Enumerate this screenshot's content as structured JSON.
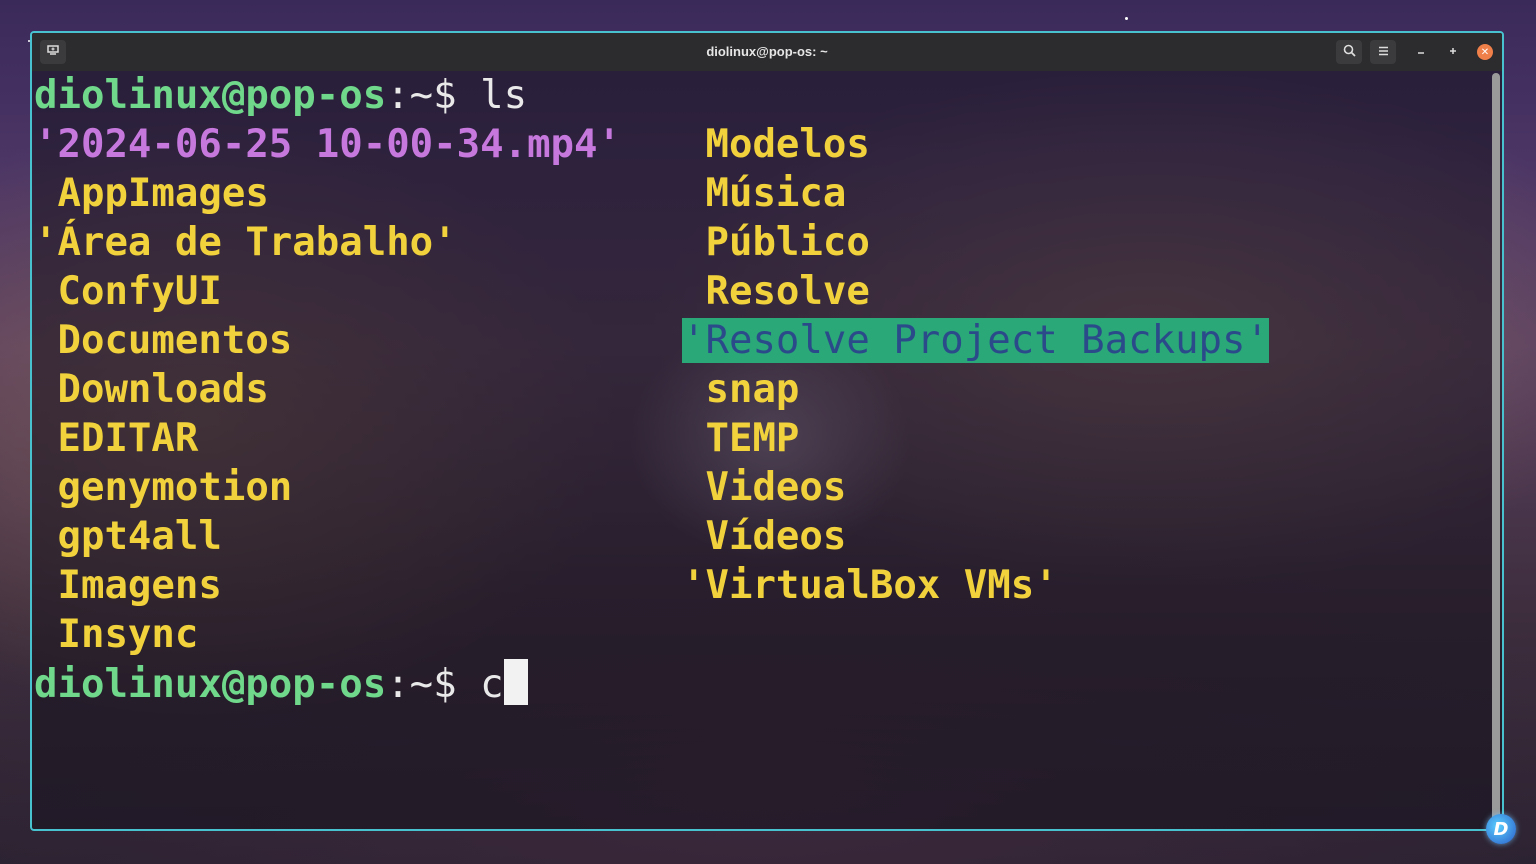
{
  "window": {
    "title": "diolinux@pop-os: ~"
  },
  "terminal": {
    "prompt": "diolinux@pop-os",
    "prompt_sep": ":~$",
    "command_1": "ls",
    "command_2_typed": "c",
    "left_column": [
      {
        "text": "'2024-06-25 10-00-34.mp4'",
        "kind": "file-video"
      },
      {
        "text": " AppImages",
        "kind": "dir"
      },
      {
        "text": "'Área de Trabalho'",
        "kind": "dir"
      },
      {
        "text": " ConfyUI",
        "kind": "dir"
      },
      {
        "text": " Documentos",
        "kind": "dir"
      },
      {
        "text": " Downloads",
        "kind": "dir"
      },
      {
        "text": " EDITAR",
        "kind": "dir"
      },
      {
        "text": " genymotion",
        "kind": "dir"
      },
      {
        "text": " gpt4all",
        "kind": "dir"
      },
      {
        "text": " Imagens",
        "kind": "dir"
      },
      {
        "text": " Insync",
        "kind": "dir"
      }
    ],
    "right_column": [
      {
        "text": " Modelos",
        "kind": "dir"
      },
      {
        "text": " Música",
        "kind": "dir"
      },
      {
        "text": " Público",
        "kind": "dir"
      },
      {
        "text": " Resolve",
        "kind": "dir"
      },
      {
        "text": "'Resolve Project Backups'",
        "kind": "hl"
      },
      {
        "text": " snap",
        "kind": "dir"
      },
      {
        "text": " TEMP",
        "kind": "dir"
      },
      {
        "text": " Videos",
        "kind": "dir"
      },
      {
        "text": " Vídeos",
        "kind": "dir"
      },
      {
        "text": "'VirtualBox VMs'",
        "kind": "dir"
      }
    ]
  },
  "colors": {
    "window_border": "#48c2cf",
    "prompt_green": "#6fd88a",
    "dir_yellow": "#f2d23c",
    "video_purple": "#c678dd",
    "highlight_bg": "#2aa878",
    "highlight_fg": "#2a4a8a"
  },
  "icons": {
    "new_tab": "new-tab-icon",
    "search": "search-icon",
    "menu": "hamburger-menu-icon",
    "minimize": "minimize-icon",
    "maximize": "maximize-icon",
    "close": "close-icon",
    "watermark": "diolinux-logo-icon"
  }
}
